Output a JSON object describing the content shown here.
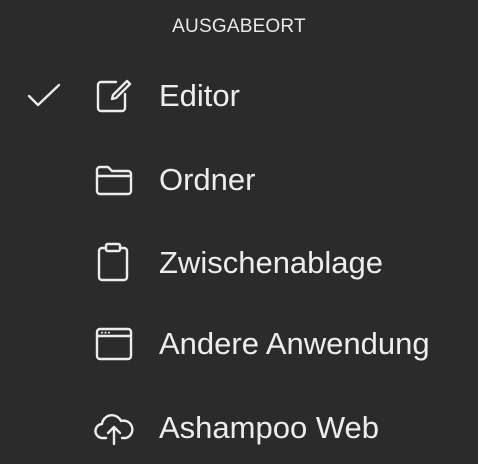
{
  "menu": {
    "header": "AUSGABEORT",
    "items": [
      {
        "label": "Editor",
        "icon": "edit-icon",
        "checked": true
      },
      {
        "label": "Ordner",
        "icon": "folder-icon",
        "checked": false
      },
      {
        "label": "Zwischenablage",
        "icon": "clipboard-icon",
        "checked": false
      },
      {
        "label": "Andere Anwendung",
        "icon": "window-icon",
        "checked": false
      },
      {
        "label": "Ashampoo Web",
        "icon": "cloud-upload-icon",
        "checked": false
      }
    ]
  },
  "colors": {
    "background": "#2b2b2b",
    "text": "#ececec"
  }
}
